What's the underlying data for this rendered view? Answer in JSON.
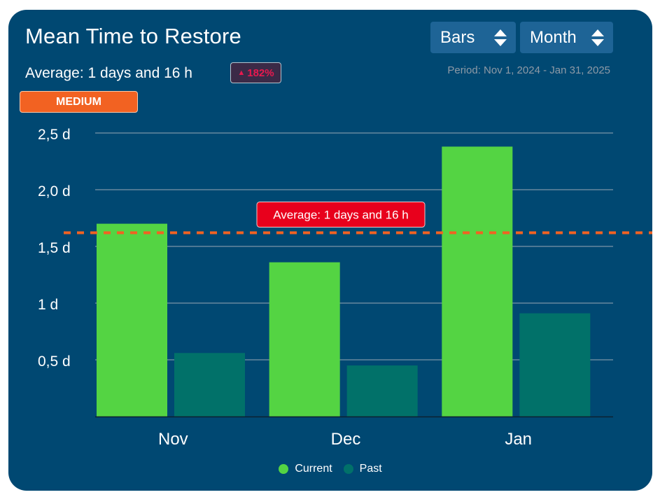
{
  "card": {
    "title": "Mean Time to Restore",
    "average_text": "Average: 1 days and 16 h",
    "delta": {
      "arrow_icon": "triangle-up-icon",
      "arrow_glyph": "▲",
      "value": "182%",
      "color": "#e8194f"
    },
    "level_badge": {
      "label": "MEDIUM",
      "color": "#f26222"
    },
    "controls": {
      "chart_type": {
        "value": "Bars",
        "icon": "sort-arrows-icon"
      },
      "granularity": {
        "value": "Month",
        "icon": "sort-arrows-icon"
      }
    },
    "period": "Period: Nov 1, 2024 - Jan 31, 2025"
  },
  "colors": {
    "background": "#004872",
    "current": "#54d443",
    "past": "#017169",
    "average_line": "#f26222",
    "average_label_bg": "#e8001c",
    "grid": "#9aa8b4"
  },
  "chart_data": {
    "type": "bar",
    "title": "Mean Time to Restore",
    "xlabel": "",
    "ylabel": "",
    "unit": "days",
    "categories": [
      "Nov",
      "Dec",
      "Jan"
    ],
    "series": [
      {
        "name": "Current",
        "values": [
          1.7,
          1.36,
          2.38
        ]
      },
      {
        "name": "Past",
        "values": [
          0.56,
          0.45,
          0.91
        ]
      }
    ],
    "ylim": [
      0,
      2.5
    ],
    "yticks": [
      {
        "value": 0.5,
        "label": "0,5 d"
      },
      {
        "value": 1.0,
        "label": "1 d"
      },
      {
        "value": 1.5,
        "label": "1,5 d"
      },
      {
        "value": 2.0,
        "label": "2,0 d"
      },
      {
        "value": 2.5,
        "label": "2,5 d"
      }
    ],
    "grid": true,
    "reference_line": {
      "value": 1.62,
      "label": "Average: 1 days and 16 h",
      "style": "dashed"
    },
    "legend": {
      "position": "bottom",
      "entries": [
        "Current",
        "Past"
      ]
    }
  }
}
